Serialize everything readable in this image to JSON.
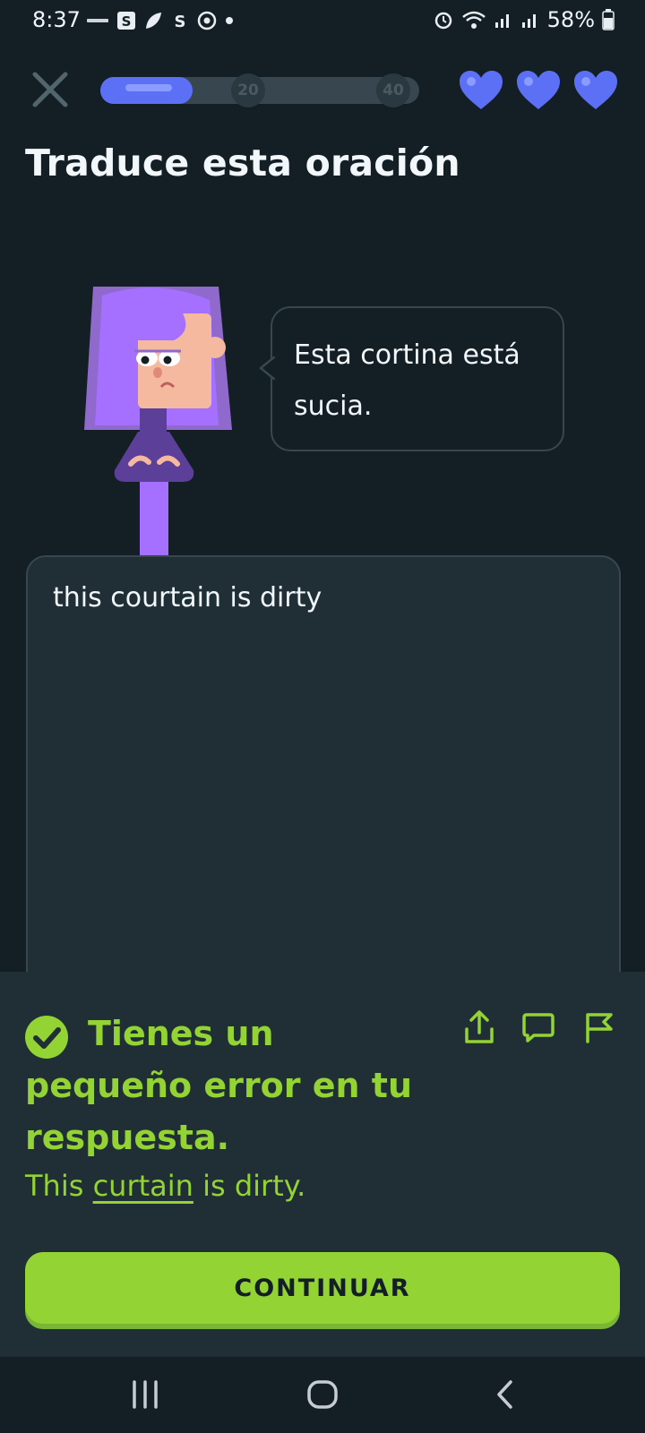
{
  "status_bar": {
    "time": "8:37",
    "battery": "58%",
    "left_icons": [
      "news-icon",
      "s-app-icon",
      "leaf-icon",
      "s-circle-icon",
      "target-icon",
      "dot-icon"
    ],
    "right_icons": [
      "alarm-icon",
      "wifi-icon",
      "signal-icon",
      "signal-icon",
      "battery-icon"
    ]
  },
  "top": {
    "progress": 0.15,
    "milestones": [
      "20",
      "40"
    ],
    "hearts_count": 3,
    "accent": "#5b70f5"
  },
  "exercise": {
    "title": "Traduce esta oración",
    "prompt_sentence": "Esta cortina está sucia.",
    "user_answer": "this courtain is dirty"
  },
  "feedback": {
    "title": "Tienes un pequeño error en tu respuesta.",
    "correct_before": "This ",
    "correct_highlight": "curtain",
    "correct_after": " is dirty.",
    "continue_label": "CONTINUAR",
    "color": "#93d333"
  }
}
